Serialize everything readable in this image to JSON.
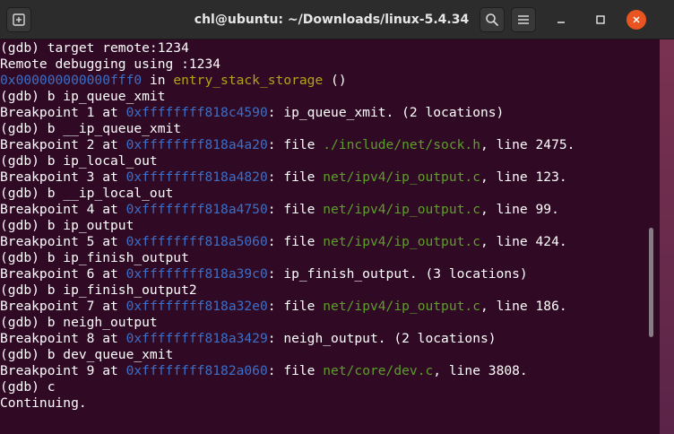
{
  "window": {
    "title": "chl@ubuntu: ~/Downloads/linux-5.4.34"
  },
  "icons": {
    "new_tab": "new-tab-icon",
    "search": "search-icon",
    "menu": "hamburger-menu-icon",
    "minimize": "minimize-icon",
    "maximize": "maximize-icon",
    "close": "close-icon"
  },
  "colors": {
    "background": "#300a24",
    "text": "#ffffff",
    "address": "#3b6fc8",
    "path": "#5e9e2a",
    "function": "#b5a21a",
    "close_button": "#e95420"
  },
  "terminal": {
    "lines": [
      [
        {
          "text": "(gdb) target remote:1234"
        }
      ],
      [
        {
          "text": "Remote debugging using :1234"
        }
      ],
      [
        {
          "text": "0x000000000000fff0",
          "style": "addr"
        },
        {
          "text": " in "
        },
        {
          "text": "entry_stack_storage",
          "style": "func"
        },
        {
          "text": " ()"
        }
      ],
      [
        {
          "text": "(gdb) b ip_queue_xmit"
        }
      ],
      [
        {
          "text": "Breakpoint 1 at "
        },
        {
          "text": "0xffffffff818c4590",
          "style": "addr"
        },
        {
          "text": ": ip_queue_xmit. (2 locations)"
        }
      ],
      [
        {
          "text": "(gdb) b __ip_queue_xmit"
        }
      ],
      [
        {
          "text": "Breakpoint 2 at "
        },
        {
          "text": "0xffffffff818a4a20",
          "style": "addr"
        },
        {
          "text": ": file "
        },
        {
          "text": "./include/net/sock.h",
          "style": "path"
        },
        {
          "text": ", line 2475."
        }
      ],
      [
        {
          "text": "(gdb) b ip_local_out"
        }
      ],
      [
        {
          "text": "Breakpoint 3 at "
        },
        {
          "text": "0xffffffff818a4820",
          "style": "addr"
        },
        {
          "text": ": file "
        },
        {
          "text": "net/ipv4/ip_output.c",
          "style": "path"
        },
        {
          "text": ", line 123."
        }
      ],
      [
        {
          "text": "(gdb) b __ip_local_out"
        }
      ],
      [
        {
          "text": "Breakpoint 4 at "
        },
        {
          "text": "0xffffffff818a4750",
          "style": "addr"
        },
        {
          "text": ": file "
        },
        {
          "text": "net/ipv4/ip_output.c",
          "style": "path"
        },
        {
          "text": ", line 99."
        }
      ],
      [
        {
          "text": "(gdb) b ip_output"
        }
      ],
      [
        {
          "text": "Breakpoint 5 at "
        },
        {
          "text": "0xffffffff818a5060",
          "style": "addr"
        },
        {
          "text": ": file "
        },
        {
          "text": "net/ipv4/ip_output.c",
          "style": "path"
        },
        {
          "text": ", line 424."
        }
      ],
      [
        {
          "text": "(gdb) b ip_finish_output"
        }
      ],
      [
        {
          "text": "Breakpoint 6 at "
        },
        {
          "text": "0xffffffff818a39c0",
          "style": "addr"
        },
        {
          "text": ": ip_finish_output. (3 locations)"
        }
      ],
      [
        {
          "text": "(gdb) b ip_finish_output2"
        }
      ],
      [
        {
          "text": "Breakpoint 7 at "
        },
        {
          "text": "0xffffffff818a32e0",
          "style": "addr"
        },
        {
          "text": ": file "
        },
        {
          "text": "net/ipv4/ip_output.c",
          "style": "path"
        },
        {
          "text": ", line 186."
        }
      ],
      [
        {
          "text": "(gdb) b neigh_output"
        }
      ],
      [
        {
          "text": "Breakpoint 8 at "
        },
        {
          "text": "0xffffffff818a3429",
          "style": "addr"
        },
        {
          "text": ": neigh_output. (2 locations)"
        }
      ],
      [
        {
          "text": "(gdb) b dev_queue_xmit"
        }
      ],
      [
        {
          "text": "Breakpoint 9 at "
        },
        {
          "text": "0xffffffff8182a060",
          "style": "addr"
        },
        {
          "text": ": file "
        },
        {
          "text": "net/core/dev.c",
          "style": "path"
        },
        {
          "text": ", line 3808."
        }
      ],
      [
        {
          "text": "(gdb) c"
        }
      ],
      [
        {
          "text": "Continuing."
        }
      ]
    ]
  }
}
